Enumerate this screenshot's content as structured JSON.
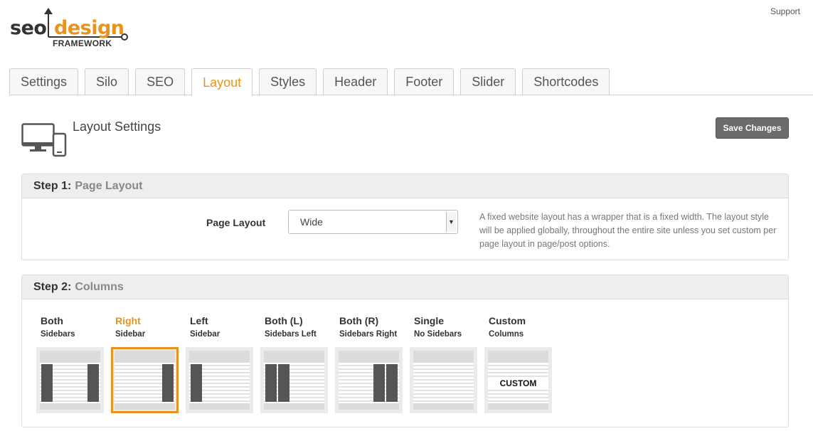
{
  "brand": {
    "seo": "seo",
    "design": "design",
    "framework": "FRAMEWORK",
    "accent": "#e8931e"
  },
  "header": {
    "support": "Support"
  },
  "tabs": [
    {
      "label": "Settings"
    },
    {
      "label": "Silo"
    },
    {
      "label": "SEO"
    },
    {
      "label": "Layout",
      "active": true
    },
    {
      "label": "Styles"
    },
    {
      "label": "Header"
    },
    {
      "label": "Footer"
    },
    {
      "label": "Slider"
    },
    {
      "label": "Shortcodes"
    }
  ],
  "page": {
    "title": "Layout Settings",
    "icon": "monitor-tablet-icon",
    "save_label": "Save Changes"
  },
  "step1": {
    "step": "Step 1:",
    "name": "Page Layout",
    "field_label": "Page Layout",
    "select_value": "Wide",
    "help": "A fixed website layout has a wrapper that is a fixed width. The layout style will be applied globally, throughout the entire site unless you set custom per page layout in page/post options."
  },
  "step2": {
    "step": "Step 2:",
    "name": "Columns",
    "options": [
      {
        "title": "Both",
        "sub": "Sidebars"
      },
      {
        "title": "Right",
        "sub": "Sidebar",
        "selected": true
      },
      {
        "title": "Left",
        "sub": "Sidebar"
      },
      {
        "title": "Both (L)",
        "sub": "Sidebars Left"
      },
      {
        "title": "Both (R)",
        "sub": "Sidebars Right"
      },
      {
        "title": "Single",
        "sub": "No Sidebars"
      },
      {
        "title": "Custom",
        "sub": "Columns",
        "thumb_text": "CUSTOM"
      }
    ]
  }
}
